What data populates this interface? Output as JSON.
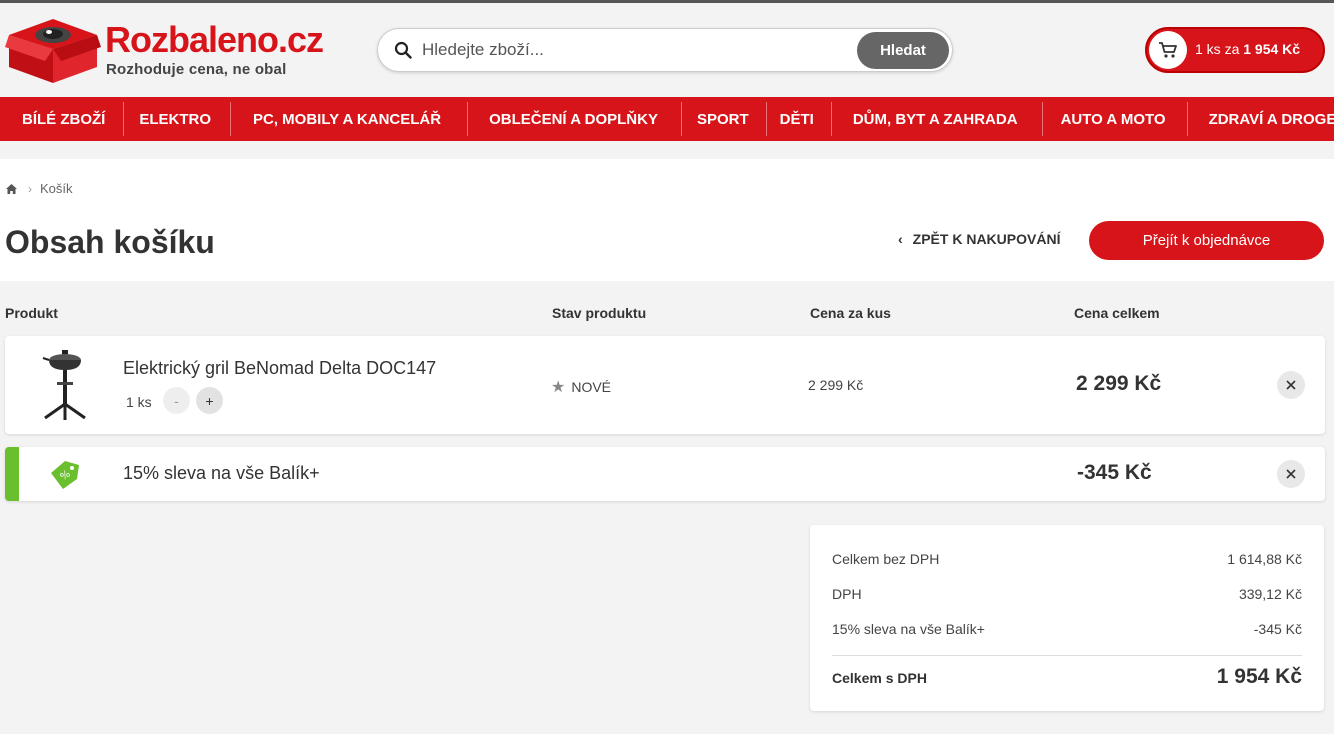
{
  "header": {
    "logo_name": "Rozbaleno.cz",
    "logo_tagline": "Rozhoduje cena, ne obal",
    "search_placeholder": "Hledejte zboží...",
    "search_button": "Hledat",
    "cart_prefix": "1 ks za",
    "cart_amount": "1 954 Kč"
  },
  "nav": [
    "BÍLÉ ZBOŽÍ",
    "ELEKTRO",
    "PC, MOBILY A KANCELÁŘ",
    "OBLEČENÍ A DOPLŇKY",
    "SPORT",
    "DĚTI",
    "DŮM, BYT A ZAHRADA",
    "AUTO A MOTO",
    "ZDRAVÍ A DROGERIE"
  ],
  "breadcrumb": {
    "current": "Košík"
  },
  "page": {
    "title": "Obsah košíku",
    "back_link": "ZPĚT K NAKUPOVÁNÍ",
    "order_button": "Přejít k objednávce"
  },
  "table": {
    "headers": [
      "Produkt",
      "Stav produktu",
      "Cena za kus",
      "Cena celkem"
    ]
  },
  "item": {
    "name": "Elektrický gril BeNomad Delta DOC147",
    "quantity": "1 ks",
    "minus": "-",
    "plus": "+",
    "condition": "NOVÉ",
    "unit_price": "2 299 Kč",
    "total_price": "2 299 Kč"
  },
  "discount": {
    "name": "15% sleva na vše Balík+",
    "amount": "-345 Kč",
    "accent_color": "#6abf2f"
  },
  "summary": {
    "rows": [
      {
        "label": "Celkem bez DPH",
        "value": "1 614,88 Kč"
      },
      {
        "label": "DPH",
        "value": "339,12 Kč"
      },
      {
        "label": "15% sleva na vše Balík+",
        "value": "-345 Kč"
      }
    ],
    "total_label": "Celkem s DPH",
    "total_value": "1 954 Kč"
  },
  "colors": {
    "brand": "#d7141a"
  }
}
